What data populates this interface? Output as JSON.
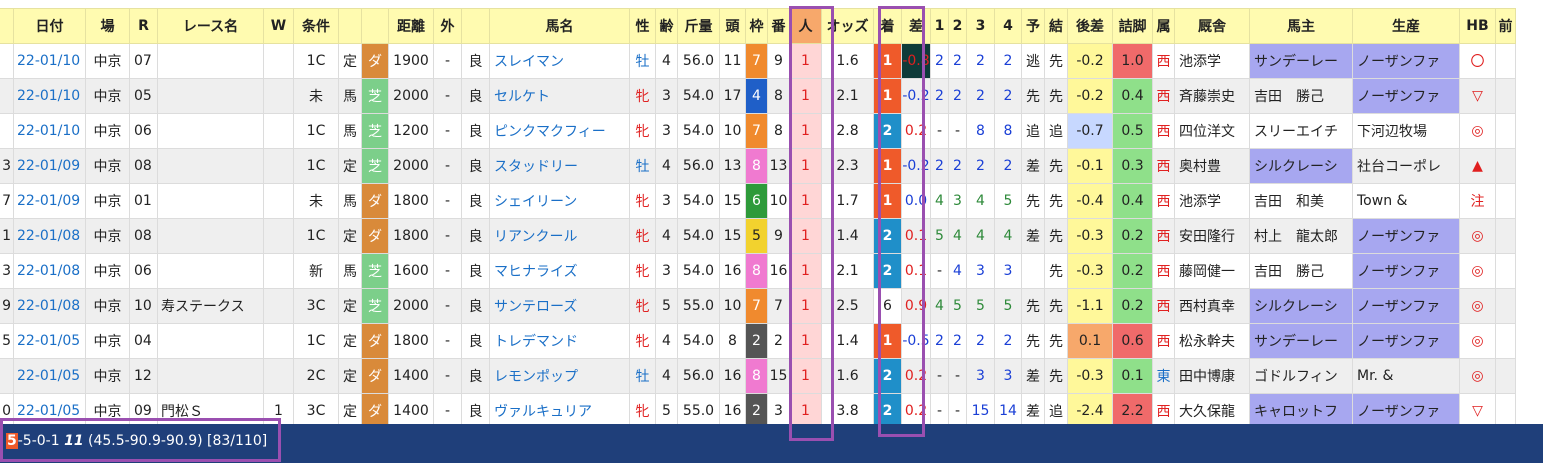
{
  "headers": [
    "",
    "日付",
    "場",
    "R",
    "レース名",
    "W",
    "条件",
    "",
    "",
    "距離",
    "外",
    "",
    "馬名",
    "性",
    "齢",
    "斤量",
    "頭",
    "枠",
    "番",
    "人",
    "オッズ",
    "着",
    "差",
    "1",
    "2",
    "3",
    "4",
    "予",
    "結",
    "後差",
    "詰脚",
    "属",
    "厩舎",
    "馬主",
    "生産",
    "HB",
    "前"
  ],
  "rows": [
    {
      "prefix": "",
      "date": "22-01/10",
      "place": "中京",
      "race": "07",
      "race_name": "",
      "w": "",
      "class": "1C",
      "cond1": "定",
      "surface": "ダ",
      "dist": "1900",
      "outer": "-",
      "going": "良",
      "horse": "スレイマン",
      "sex": "牡",
      "age": "4",
      "weight": "56.0",
      "heads": "11",
      "frame": "7",
      "num": "9",
      "pop": "1",
      "odds": "1.6",
      "fin": "1",
      "margin": "-0.8",
      "c1": "2",
      "c2": "2",
      "c3": "2",
      "c4": "2",
      "pred": "逃",
      "result": "先",
      "late": "-0.2",
      "leg": "1.0",
      "zoku": "西",
      "trainer": "池添学",
      "owner": "サンデーレー",
      "breeder": "ノーザンファ",
      "hb": "〇"
    },
    {
      "prefix": "",
      "date": "22-01/10",
      "place": "中京",
      "race": "05",
      "race_name": "",
      "w": "",
      "class": "未",
      "cond1": "馬",
      "surface": "芝",
      "dist": "2000",
      "outer": "-",
      "going": "良",
      "horse": "セルケト",
      "sex": "牝",
      "age": "3",
      "weight": "54.0",
      "heads": "17",
      "frame": "4",
      "num": "8",
      "pop": "1",
      "odds": "2.1",
      "fin": "1",
      "margin": "-0.2",
      "c1": "2",
      "c2": "2",
      "c3": "2",
      "c4": "2",
      "pred": "先",
      "result": "先",
      "late": "-0.2",
      "leg": "0.4",
      "zoku": "西",
      "trainer": "斉藤崇史",
      "owner": "吉田　勝己",
      "breeder": "ノーザンファ",
      "hb": "▽"
    },
    {
      "prefix": "",
      "date": "22-01/10",
      "place": "中京",
      "race": "06",
      "race_name": "",
      "w": "",
      "class": "1C",
      "cond1": "馬",
      "surface": "芝",
      "dist": "1200",
      "outer": "-",
      "going": "良",
      "horse": "ピンクマクフィー",
      "sex": "牝",
      "age": "3",
      "weight": "54.0",
      "heads": "10",
      "frame": "7",
      "num": "8",
      "pop": "1",
      "odds": "2.8",
      "fin": "2",
      "margin": "0.2",
      "c1": "-",
      "c2": "-",
      "c3": "8",
      "c4": "8",
      "pred": "追",
      "result": "追",
      "late": "-0.7",
      "leg": "0.5",
      "zoku": "西",
      "trainer": "四位洋文",
      "owner": "スリーエイチ",
      "breeder": "下河辺牧場",
      "hb": "◎"
    },
    {
      "prefix": "3",
      "date": "22-01/09",
      "place": "中京",
      "race": "08",
      "race_name": "",
      "w": "",
      "class": "1C",
      "cond1": "定",
      "surface": "芝",
      "dist": "2000",
      "outer": "-",
      "going": "良",
      "horse": "スタッドリー",
      "sex": "牡",
      "age": "4",
      "weight": "56.0",
      "heads": "13",
      "frame": "8",
      "num": "13",
      "pop": "1",
      "odds": "2.3",
      "fin": "1",
      "margin": "-0.2",
      "c1": "2",
      "c2": "2",
      "c3": "2",
      "c4": "2",
      "pred": "差",
      "result": "先",
      "late": "-0.1",
      "leg": "0.3",
      "zoku": "西",
      "trainer": "奥村豊",
      "owner": "シルクレーシ",
      "breeder": "社台コーポレ",
      "hb": "▲"
    },
    {
      "prefix": "7",
      "date": "22-01/09",
      "place": "中京",
      "race": "01",
      "race_name": "",
      "w": "",
      "class": "未",
      "cond1": "馬",
      "surface": "ダ",
      "dist": "1800",
      "outer": "-",
      "going": "良",
      "horse": "シェイリーン",
      "sex": "牝",
      "age": "3",
      "weight": "54.0",
      "heads": "15",
      "frame": "6",
      "num": "10",
      "pop": "1",
      "odds": "1.7",
      "fin": "1",
      "margin": "0.0",
      "c1": "4",
      "c2": "3",
      "c3": "4",
      "c4": "5",
      "pred": "先",
      "result": "先",
      "late": "-0.4",
      "leg": "0.4",
      "zoku": "西",
      "trainer": "池添学",
      "owner": "吉田　和美",
      "breeder": "Town &",
      "hb": "注"
    },
    {
      "prefix": "1",
      "date": "22-01/08",
      "place": "中京",
      "race": "08",
      "race_name": "",
      "w": "",
      "class": "1C",
      "cond1": "定",
      "surface": "ダ",
      "dist": "1800",
      "outer": "-",
      "going": "良",
      "horse": "リアンクール",
      "sex": "牝",
      "age": "4",
      "weight": "54.0",
      "heads": "15",
      "frame": "5",
      "num": "9",
      "pop": "1",
      "odds": "1.4",
      "fin": "2",
      "margin": "0.1",
      "c1": "5",
      "c2": "4",
      "c3": "4",
      "c4": "4",
      "pred": "差",
      "result": "先",
      "late": "-0.3",
      "leg": "0.2",
      "zoku": "西",
      "trainer": "安田隆行",
      "owner": "村上　龍太郎",
      "breeder": "ノーザンファ",
      "hb": "◎"
    },
    {
      "prefix": "3",
      "date": "22-01/08",
      "place": "中京",
      "race": "06",
      "race_name": "",
      "w": "",
      "class": "新",
      "cond1": "馬",
      "surface": "芝",
      "dist": "1600",
      "outer": "-",
      "going": "良",
      "horse": "マヒナライズ",
      "sex": "牝",
      "age": "3",
      "weight": "54.0",
      "heads": "16",
      "frame": "8",
      "num": "16",
      "pop": "1",
      "odds": "2.1",
      "fin": "2",
      "margin": "0.1",
      "c1": "-",
      "c2": "4",
      "c3": "3",
      "c4": "3",
      "pred": "",
      "result": "先",
      "late": "-0.3",
      "leg": "0.2",
      "zoku": "西",
      "trainer": "藤岡健一",
      "owner": "吉田　勝己",
      "breeder": "ノーザンファ",
      "hb": "◎"
    },
    {
      "prefix": "9",
      "date": "22-01/08",
      "place": "中京",
      "race": "10",
      "race_name": "寿ステークス",
      "w": "",
      "class": "3C",
      "cond1": "定",
      "surface": "芝",
      "dist": "2000",
      "outer": "-",
      "going": "良",
      "horse": "サンテローズ",
      "sex": "牝",
      "age": "5",
      "weight": "55.0",
      "heads": "10",
      "frame": "7",
      "num": "7",
      "pop": "1",
      "odds": "2.5",
      "fin": "6",
      "margin": "0.9",
      "c1": "4",
      "c2": "5",
      "c3": "5",
      "c4": "5",
      "pred": "先",
      "result": "先",
      "late": "-1.1",
      "leg": "0.2",
      "zoku": "西",
      "trainer": "西村真幸",
      "owner": "シルクレーシ",
      "breeder": "ノーザンファ",
      "hb": "◎"
    },
    {
      "prefix": "5",
      "date": "22-01/05",
      "place": "中京",
      "race": "04",
      "race_name": "",
      "w": "",
      "class": "1C",
      "cond1": "定",
      "surface": "ダ",
      "dist": "1800",
      "outer": "-",
      "going": "良",
      "horse": "トレデマンド",
      "sex": "牝",
      "age": "4",
      "weight": "54.0",
      "heads": "8",
      "frame": "2",
      "num": "2",
      "pop": "1",
      "odds": "1.4",
      "fin": "1",
      "margin": "-0.5",
      "c1": "2",
      "c2": "2",
      "c3": "2",
      "c4": "2",
      "pred": "先",
      "result": "先",
      "late": "0.1",
      "leg": "0.6",
      "zoku": "西",
      "trainer": "松永幹夫",
      "owner": "サンデーレー",
      "breeder": "ノーザンファ",
      "hb": "◎"
    },
    {
      "prefix": "",
      "date": "22-01/05",
      "place": "中京",
      "race": "12",
      "race_name": "",
      "w": "",
      "class": "2C",
      "cond1": "定",
      "surface": "ダ",
      "dist": "1400",
      "outer": "-",
      "going": "良",
      "horse": "レモンポップ",
      "sex": "牡",
      "age": "4",
      "weight": "56.0",
      "heads": "16",
      "frame": "8",
      "num": "15",
      "pop": "1",
      "odds": "1.6",
      "fin": "2",
      "margin": "0.2",
      "c1": "-",
      "c2": "-",
      "c3": "3",
      "c4": "3",
      "pred": "差",
      "result": "先",
      "late": "-0.3",
      "leg": "0.1",
      "zoku": "東",
      "trainer": "田中博康",
      "owner": "ゴドルフィン",
      "breeder": "Mr. &",
      "hb": "◎"
    },
    {
      "prefix": "0",
      "date": "22-01/05",
      "place": "中京",
      "race": "09",
      "race_name": "門松Ｓ",
      "w": "1",
      "class": "3C",
      "cond1": "定",
      "surface": "ダ",
      "dist": "1400",
      "outer": "-",
      "going": "良",
      "horse": "ヴァルキュリア",
      "sex": "牝",
      "age": "5",
      "weight": "55.0",
      "heads": "16",
      "frame": "2",
      "num": "3",
      "pop": "1",
      "odds": "3.8",
      "fin": "2",
      "margin": "0.2",
      "c1": "-",
      "c2": "-",
      "c3": "15",
      "c4": "14",
      "pred": "差",
      "result": "追",
      "late": "-2.4",
      "leg": "2.2",
      "zoku": "西",
      "trainer": "大久保龍",
      "owner": "キャロットフ",
      "breeder": "ノーザンファ",
      "hb": "▽"
    }
  ],
  "footer": {
    "first": "5",
    "rest": "-5-0-1",
    "bold": "11",
    "stats": "(45.5-90.9-90.9) [83/110]"
  }
}
